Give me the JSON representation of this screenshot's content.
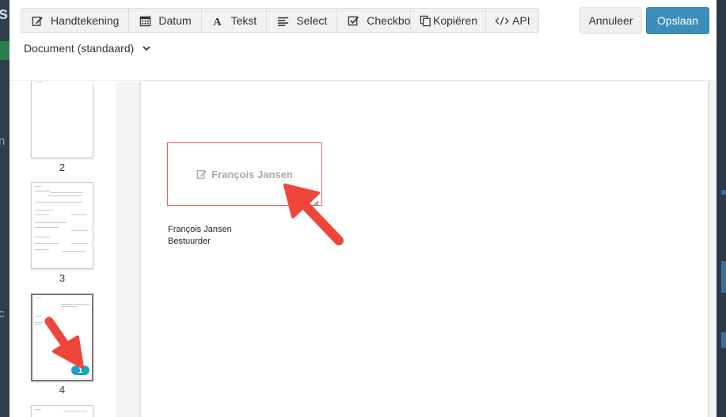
{
  "toolbar": {
    "field_buttons": [
      {
        "label": "Handtekening",
        "icon": "edit-icon"
      },
      {
        "label": "Datum",
        "icon": "calendar-icon"
      },
      {
        "label": "Tekst",
        "icon": "text-icon"
      },
      {
        "label": "Select",
        "icon": "list-icon"
      },
      {
        "label": "Checkbox",
        "icon": "checkbox-icon"
      }
    ],
    "copy_label": "Kopiëren",
    "api_label": "API",
    "cancel_label": "Annuleer",
    "save_label": "Opslaan",
    "document_select": "Document (standaard)"
  },
  "thumbnails": [
    {
      "number": "2"
    },
    {
      "number": "3"
    },
    {
      "number": "4",
      "badge": "1"
    }
  ],
  "page": {
    "signature_field_label": "François Jansen",
    "signer_name": "François Jansen",
    "signer_role": "Bestuurder"
  },
  "colors": {
    "save_button": "#3c8dbc",
    "badge": "#17a2c8",
    "signature_border": "#e06060",
    "arrow": "#f0453a"
  }
}
